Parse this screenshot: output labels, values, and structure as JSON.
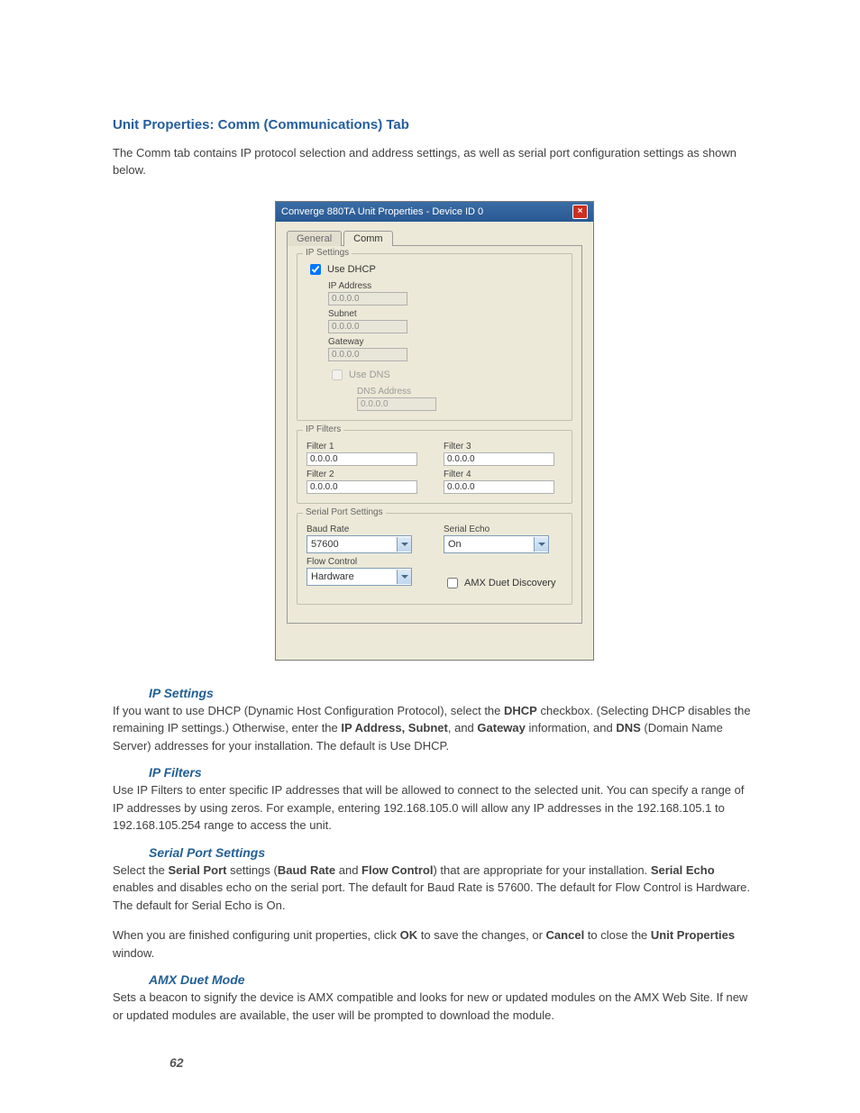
{
  "doc": {
    "heading": "Unit Properties: Comm (Communications) Tab",
    "intro": "The Comm tab contains IP protocol selection and address settings, as well as serial port configuration settings as shown below.",
    "ip_settings_h": "IP Settings",
    "ip_settings_p": "If you want to use DHCP (Dynamic Host Configuration Protocol), select the <b>DHCP</b> checkbox. (Selecting DHCP disables the remaining IP settings.) Otherwise, enter the <b>IP Address, Subnet</b>, and <b>Gateway</b> information, and <b>DNS</b> (Domain Name Server) addresses for your installation. The default is Use DHCP.",
    "ip_filters_h": "IP Filters",
    "ip_filters_p": "Use IP Filters to enter specific IP addresses that will be allowed to connect to the selected unit. You can specify a range of IP addresses by using zeros. For example, entering 192.168.105.0 will allow any IP addresses in the 192.168.105.1 to 192.168.105.254 range to access the unit.",
    "serial_h": "Serial Port Settings",
    "serial_p1": "Select the <b>Serial Port</b> settings (<b>Baud Rate</b> and <b>Flow Control</b>) that are appropriate for your installation. <b>Serial Echo</b> enables and disables echo on the serial port. The default for Baud Rate is 57600. The default for Flow Control is Hardware. The default for Serial Echo is On.",
    "serial_p2": "When you are finished configuring unit properties, click <b>OK</b> to save the changes, or <b>Cancel</b> to close the <b>Unit Properties</b> window.",
    "amx_h": "AMX Duet Mode",
    "amx_p": "Sets a beacon to signify the device is AMX compatible and looks for new or updated modules on the AMX Web Site. If new or updated modules are available, the user will be prompted to download the module.",
    "pagenum": "62"
  },
  "dlg": {
    "title": "Converge 880TA Unit Properties - Device ID 0",
    "tabs": {
      "general": "General",
      "comm": "Comm"
    },
    "groups": {
      "ip_settings": "IP Settings",
      "ip_filters": "IP Filters",
      "serial": "Serial Port Settings"
    },
    "ip": {
      "use_dhcp": "Use DHCP",
      "ip_addr_l": "IP Address",
      "ip_addr_v": "0.0.0.0",
      "subnet_l": "Subnet",
      "subnet_v": "0.0.0.0",
      "gateway_l": "Gateway",
      "gateway_v": "0.0.0.0",
      "use_dns": "Use DNS",
      "dns_addr_l": "DNS Address",
      "dns_addr_v": "0.0.0.0"
    },
    "filters": {
      "f1_l": "Filter 1",
      "f1_v": "0.0.0.0",
      "f2_l": "Filter 2",
      "f2_v": "0.0.0.0",
      "f3_l": "Filter 3",
      "f3_v": "0.0.0.0",
      "f4_l": "Filter 4",
      "f4_v": "0.0.0.0"
    },
    "serial": {
      "baud_l": "Baud Rate",
      "baud_v": "57600",
      "echo_l": "Serial Echo",
      "echo_v": "On",
      "flow_l": "Flow Control",
      "flow_v": "Hardware",
      "amx": "AMX Duet Discovery"
    }
  }
}
